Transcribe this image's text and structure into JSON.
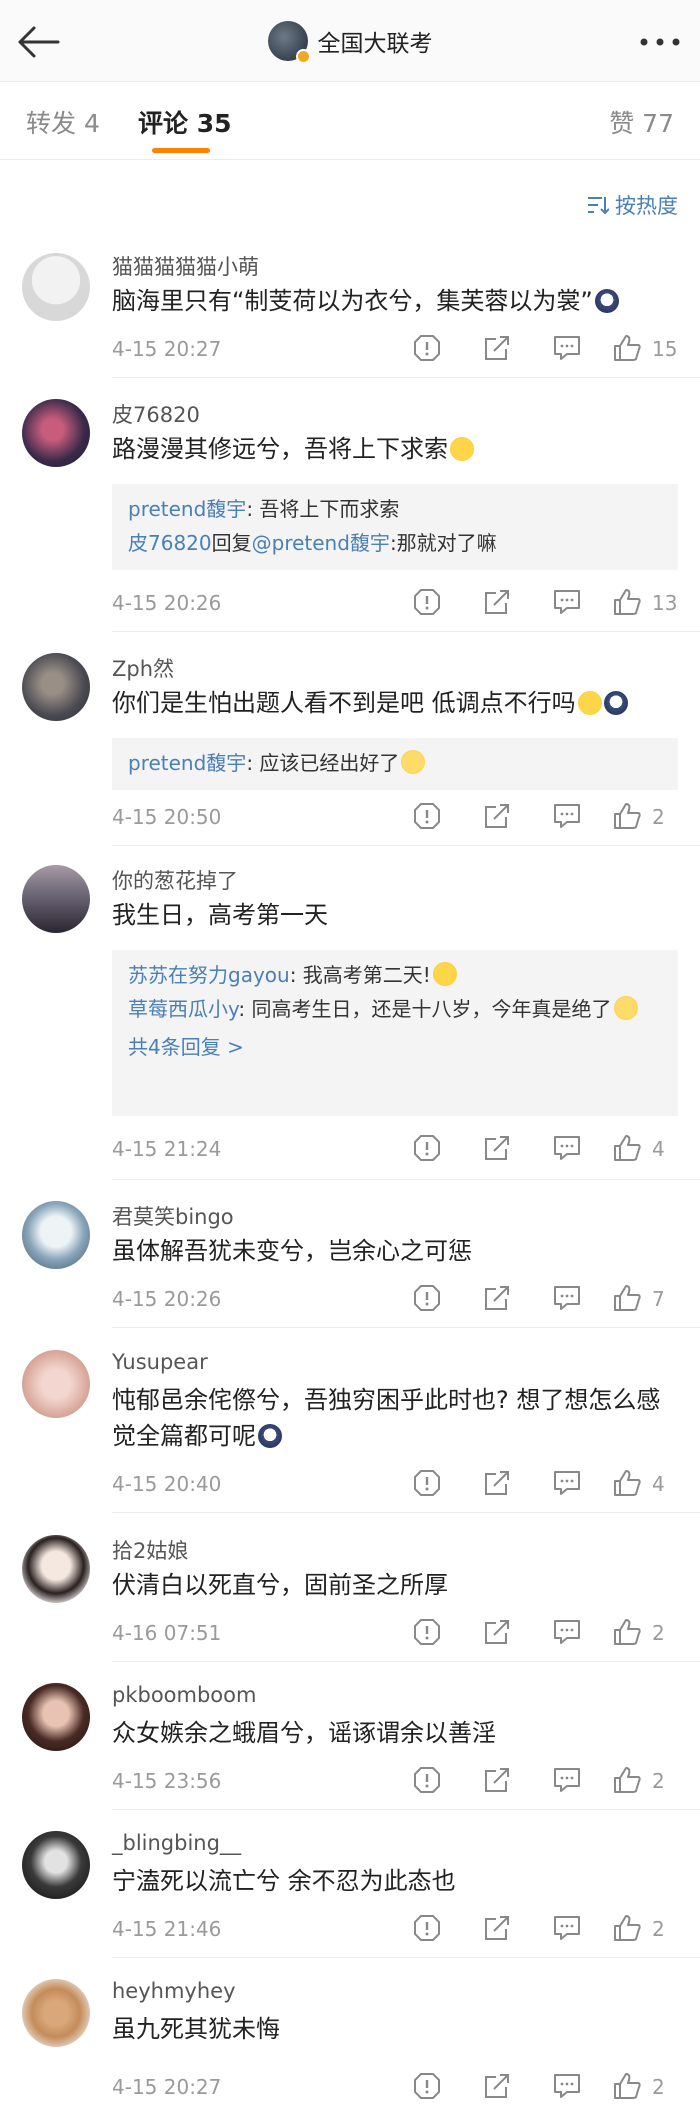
{
  "nav": {
    "title": "全国大联考"
  },
  "tabs": {
    "repost": "转发 4",
    "comment": "评论 35",
    "like": "赞 77"
  },
  "sort_label": "按热度",
  "comments": [
    {
      "user": "猫猫猫猫猫小萌",
      "text": "脑海里只有“制芰荷以为衣兮，集芙蓉以为裳”",
      "time": "4-15 20:27",
      "likes": "15"
    },
    {
      "user": "皮76820",
      "text": "路漫漫其修远兮，吾将上下求索",
      "time": "4-15 20:26",
      "likes": "13",
      "replies": [
        {
          "user": "pretend馥宇",
          "text": ": 吾将上下而求索"
        },
        {
          "user": "皮76820",
          "mid": "回复",
          "user2": "@pretend馥宇",
          "text": ":那就对了嘛"
        }
      ]
    },
    {
      "user": "Zph然",
      "text": "你们是生怕出题人看不到是吧 低调点不行吗",
      "time": "4-15 20:50",
      "likes": "2",
      "replies": [
        {
          "user": "pretend馥宇",
          "text": ": 应该已经出好了"
        }
      ]
    },
    {
      "user": "你的葱花掉了",
      "text": "我生日，高考第一天",
      "time": "4-15 21:24",
      "likes": "4",
      "replies": [
        {
          "user": "苏苏在努力gayou",
          "text": ": 我高考第二天!"
        },
        {
          "user": "草莓西瓜小y",
          "text": ": 同高考生日，还是十八岁，今年真是绝了"
        }
      ],
      "more": "共4条回复 >"
    },
    {
      "user": "君莫笑bingo",
      "text": "虽体解吾犹未变兮，岂余心之可惩",
      "time": "4-15 20:26",
      "likes": "7"
    },
    {
      "user": "Yusupear",
      "text": "忳郁邑余侘傺兮，吾独穷困乎此时也? 想了想怎么感觉全篇都可呢",
      "time": "4-15 20:40",
      "likes": "4"
    },
    {
      "user": "拾2姑娘",
      "text": "伏清白以死直兮，固前圣之所厚",
      "time": "4-16 07:51",
      "likes": "2"
    },
    {
      "user": "pkboomboom",
      "text": "众女嫉余之蛾眉兮，谣诼谓余以善淫",
      "time": "4-15 23:56",
      "likes": "2"
    },
    {
      "user": "_blingbing__",
      "text": "宁溘死以流亡兮 余不忍为此态也",
      "time": "4-15 21:46",
      "likes": "2"
    },
    {
      "user": "heyhmyhey",
      "text": "虽九死其犹未悔",
      "time": "4-15 20:27",
      "likes": "2"
    }
  ],
  "colors": {
    "accent": "#ff8200",
    "link": "#4a7fb8"
  },
  "icons": [
    "back-arrow-icon",
    "more-icon",
    "sort-icon",
    "report-icon",
    "share-icon",
    "comment-icon",
    "like-icon"
  ]
}
